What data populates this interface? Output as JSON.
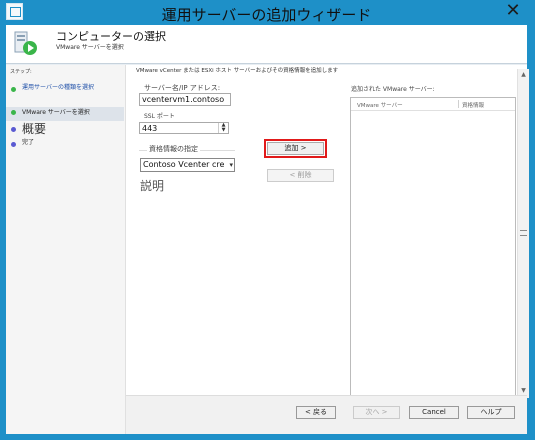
{
  "window": {
    "title": "運用サーバーの追加ウィザード",
    "close_glyph": "✕"
  },
  "header": {
    "title": "コンピューターの選択",
    "subtitle": "VMware サーバーを選択"
  },
  "left": {
    "steps_header": "ステップ:",
    "steps": [
      {
        "label": "運用サーバーの種類を選択",
        "status": "done"
      },
      {
        "label": "VMware サーバーを選択",
        "status": "current"
      },
      {
        "label": "概要",
        "status": "pending"
      },
      {
        "label": "完了",
        "status": "pending"
      }
    ]
  },
  "main": {
    "instruction": "VMware vCenter または ESXi ホスト サーバーおよびその資格情報を追加します",
    "server_label": "サーバー名/IP アドレス:",
    "server_value": "vcentervm1.contoso",
    "ssl_label": "SSL ポート",
    "ssl_value": "443",
    "cred_group_label": "資格情報の指定",
    "cred_selected": "Contoso Vcenter cre",
    "description_label": "説明",
    "add_button": "追加 >",
    "remove_button": "< 削除",
    "added_label": "追加された VMware サーバー:",
    "list_columns": [
      "VMware サーバー",
      "資格情報"
    ]
  },
  "footer": {
    "back": "< 戻る",
    "next": "次へ >",
    "cancel": "Cancel",
    "help": "ヘルプ"
  },
  "colors": {
    "accent": "#1e90c8",
    "highlight": "#e11a1a",
    "done_dot": "#3ab54a",
    "pending_dot": "#5a5ad2"
  }
}
